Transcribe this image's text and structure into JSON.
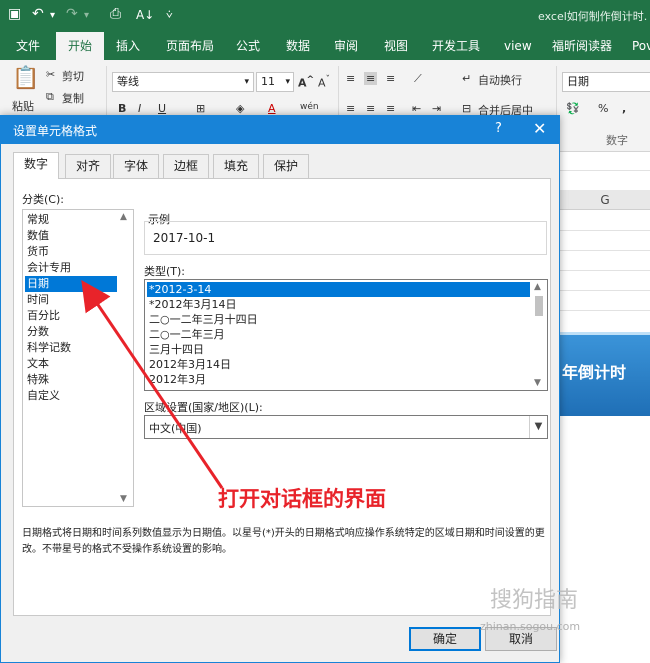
{
  "excel": {
    "doc_title": "excel如何制作倒计时.",
    "quick_access": [
      "save-icon",
      "undo-icon",
      "redo-icon",
      "print-preview-icon",
      "sort-icon",
      "customize-icon"
    ],
    "tabs": [
      "文件",
      "开始",
      "插入",
      "页面布局",
      "公式",
      "数据",
      "审阅",
      "视图",
      "开发工具",
      "view",
      "福昕阅读器",
      "Pov"
    ],
    "active_tab": "开始",
    "ribbon": {
      "paste": "粘贴",
      "cut": "剪切",
      "copy": "复制",
      "font_name": "等线",
      "font_size": "11",
      "wrap_text": "自动换行",
      "merge": "合并后居中",
      "number_format": "日期",
      "number_group": "数字",
      "percent": "%"
    },
    "sheet": {
      "column_header": "G",
      "banner_text": "年倒计时"
    }
  },
  "dialog": {
    "title": "设置单元格格式",
    "help": "?",
    "close": "✕",
    "tabs": [
      "数字",
      "对齐",
      "字体",
      "边框",
      "填充",
      "保护"
    ],
    "active_tab": "数字",
    "category_label": "分类(C):",
    "categories": [
      "常规",
      "数值",
      "货币",
      "会计专用",
      "日期",
      "时间",
      "百分比",
      "分数",
      "科学记数",
      "文本",
      "特殊",
      "自定义"
    ],
    "selected_category": "日期",
    "sample_label": "示例",
    "sample_value": "2017-10-1",
    "type_label": "类型(T):",
    "types": [
      "*2012-3-14",
      "*2012年3月14日",
      "二○一二年三月十四日",
      "二○一二年三月",
      "三月十四日",
      "2012年3月14日",
      "2012年3月"
    ],
    "selected_type": "*2012-3-14",
    "locale_label": "区域设置(国家/地区)(L):",
    "locale_value": "中文(中国)",
    "description": "日期格式将日期和时间系列数值显示为日期值。以星号(*)开头的日期格式响应操作系统特定的区域日期和时间设置的更改。不带星号的格式不受操作系统设置的影响。",
    "ok": "确定",
    "cancel": "取消"
  },
  "annotation": {
    "text": "打开对话框的界面",
    "color": "#e8232a"
  },
  "watermark": {
    "text": "搜狗指南",
    "url": "zhinan.sogou.com"
  },
  "colors": {
    "excel_green": "#217346",
    "dialog_blue": "#1883d7",
    "selection_blue": "#0078d7"
  }
}
